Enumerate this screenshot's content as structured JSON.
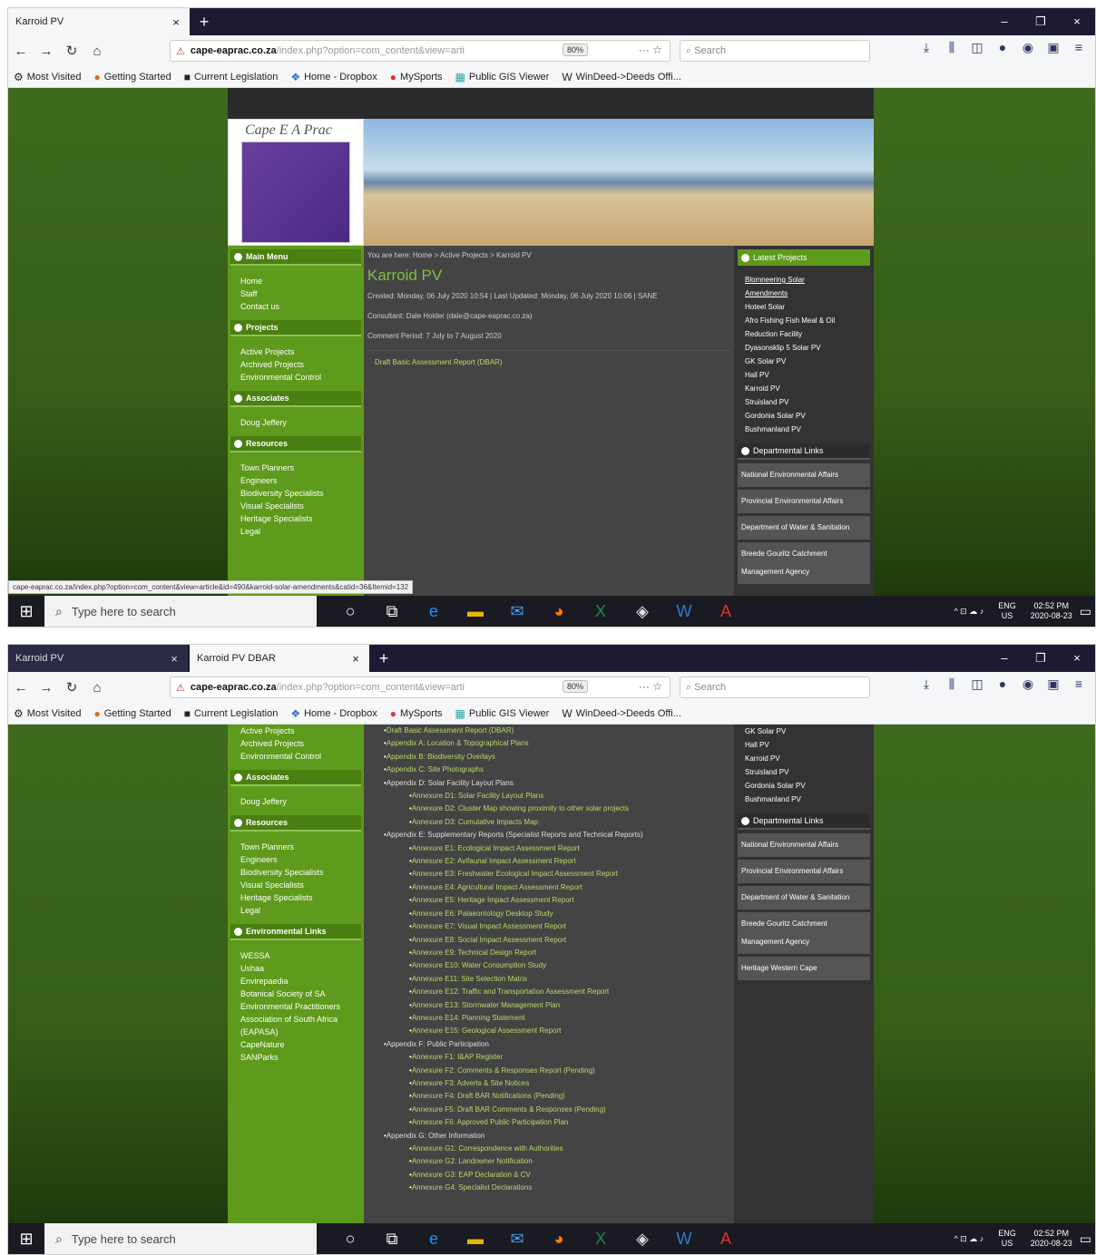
{
  "browser": {
    "url_host": "cape-eaprac.co.za",
    "url_path": "/index.php?option=com_content&view=arti",
    "zoom": "80%",
    "search_placeholder": "Search",
    "bookmarks": [
      "Most Visited",
      "Getting Started",
      "Current Legislation",
      "Home - Dropbox",
      "MySports",
      "Public GIS Viewer",
      "WinDeed->Deeds Offi..."
    ]
  },
  "s1": {
    "tabs": [
      "Karroid PV"
    ],
    "status_url": "cape-eaprac.co.za/index.php?option=com_content&view=article&id=490&karroid-solar-amendments&catid=36&Itemid=132"
  },
  "s2": {
    "tabs": [
      "Karroid PV",
      "Karroid PV DBAR"
    ]
  },
  "site": {
    "logo_text": "Cape E A Prac",
    "menus": {
      "main": {
        "title": "Main Menu",
        "items": [
          "Home",
          "Staff",
          "Contact us"
        ]
      },
      "projects": {
        "title": "Projects",
        "items": [
          "Active Projects",
          "Archived Projects",
          "Environmental Control"
        ]
      },
      "associates": {
        "title": "Associates",
        "items": [
          "Doug Jeffery"
        ]
      },
      "resources": {
        "title": "Resources",
        "items": [
          "Town Planners",
          "Engineers",
          "Biodiversity Specialists",
          "Visual Specialists",
          "Heritage Specialists",
          "Legal"
        ]
      },
      "env": {
        "title": "Environmental Links",
        "items": [
          "WESSA",
          "Ushaa",
          "Envirepaedia",
          "Botanical Society of SA",
          "Environmental Practitioners Association of South Africa (EAPASA)",
          "CapeNature",
          "SANParks"
        ]
      }
    },
    "breadcrumb": "You are here: Home > Active Projects > Karroid PV",
    "page_title": "Karroid PV",
    "created": "Created: Monday, 06 July 2020 10:54 | Last Updated: Monday, 06 July 2020 10:06 | SANE",
    "consultant": "Consultant: Dale Holder (dale@cape-eaprac.co.za)",
    "comment_period": "Comment Period: 7 July to 7 August 2020",
    "report_link": "Draft Basic Assessment Report (DBAR)",
    "latest_title": "Latest Projects",
    "latest": [
      "Blomneering Solar",
      "Amendments",
      "Hoteel Solar",
      "Afro Fishing Fish Meal & Oil",
      "Reduction Facility",
      "Dyasonsklip 5 Solar PV",
      "GK Solar PV",
      "Hall PV",
      "Karroid PV",
      "Struisland PV",
      "Gordonia Solar PV",
      "Bushmanland PV"
    ],
    "dept_title": "Departmental Links",
    "dept": [
      "National Environmental Affairs",
      "Provincial Environmental Affairs",
      "Department of Water & Sanitation",
      "Breede Gouritz Catchment Management Agency",
      "Heritage Western Cape"
    ],
    "appendices": [
      {
        "t": "Draft Basic Assessment Report (DBAR)",
        "c": "a"
      },
      {
        "t": "Appendix A: Location & Topographical Plans",
        "c": "b a"
      },
      {
        "t": "Appendix B: Biodiversity Overlays",
        "c": "b a"
      },
      {
        "t": "Appendix C: Site Photographs",
        "c": "b a"
      },
      {
        "t": "Appendix D: Solar Facility Layout Plans",
        "c": "b"
      },
      {
        "t": "Annexure D1: Solar Facility Layout Plans",
        "c": "sub a"
      },
      {
        "t": "Annexure D2: Cluster Map showing proximity to other solar projects",
        "c": "sub a"
      },
      {
        "t": "Annexure D3: Cumulative Impacts Map",
        "c": "sub a"
      },
      {
        "t": "Appendix E: Supplementary Reports (Specialist Reports and Technical Reports)",
        "c": "b"
      },
      {
        "t": "Annexure E1: Ecological Impact Assessment Report",
        "c": "sub a"
      },
      {
        "t": "Annexure E2: Avifaunal Impact Assessment Report",
        "c": "sub a"
      },
      {
        "t": "Annexure E3: Freshwater Ecological Impact Assessment Report",
        "c": "sub a"
      },
      {
        "t": "Annexure E4: Agricultural Impact Assessment Report",
        "c": "sub a"
      },
      {
        "t": "Annexure E5: Heritage Impact Assessment Report",
        "c": "sub a"
      },
      {
        "t": "Annexure E6: Palaeontology Desktop Study",
        "c": "sub a"
      },
      {
        "t": "Annexure E7: Visual Impact Assessment Report",
        "c": "sub a"
      },
      {
        "t": "Annexure E8: Social Impact Assessment Report",
        "c": "sub a"
      },
      {
        "t": "Annexure E9: Technical Design Report",
        "c": "sub a"
      },
      {
        "t": "Annexure E10: Water Consumption Study",
        "c": "sub a"
      },
      {
        "t": "Annexure E11: Site Selection Matrix",
        "c": "sub a"
      },
      {
        "t": "Annexure E12: Traffic and Transportation Assessment Report",
        "c": "sub a"
      },
      {
        "t": "Annexure E13: Stormwater Management Plan",
        "c": "sub a"
      },
      {
        "t": "Annexure E14: Planning Statement",
        "c": "sub a"
      },
      {
        "t": "Annexure E15: Geological Assessment Report",
        "c": "sub a"
      },
      {
        "t": "Appendix F: Public Participation",
        "c": "b"
      },
      {
        "t": "Annexure F1: I&AP Register",
        "c": "sub a"
      },
      {
        "t": "Annexure F2: Comments & Responses Report (Pending)",
        "c": "sub a"
      },
      {
        "t": "Annexure F3: Adverts & Site Notices",
        "c": "sub a"
      },
      {
        "t": "Annexure F4: Draft BAR Notifications (Pending)",
        "c": "sub a"
      },
      {
        "t": "Annexure F5: Draft BAR Comments & Responses (Pending)",
        "c": "sub a"
      },
      {
        "t": "Annexure F6: Approved Public Participation Plan",
        "c": "sub a"
      },
      {
        "t": "Appendix G: Other Information",
        "c": "b"
      },
      {
        "t": "Annexure G1: Correspondence with Authorities",
        "c": "sub a"
      },
      {
        "t": "Annexure G2: Landowner Notification",
        "c": "sub a"
      },
      {
        "t": "Annexure G3: EAP Declaration & CV",
        "c": "sub a"
      },
      {
        "t": "Annexure G4: Specialist Declarations",
        "c": "sub a"
      }
    ]
  },
  "taskbar": {
    "search": "Type here to search",
    "lang": "ENG",
    "region": "US",
    "time": "02:52 PM",
    "date": "2020-08-23"
  }
}
